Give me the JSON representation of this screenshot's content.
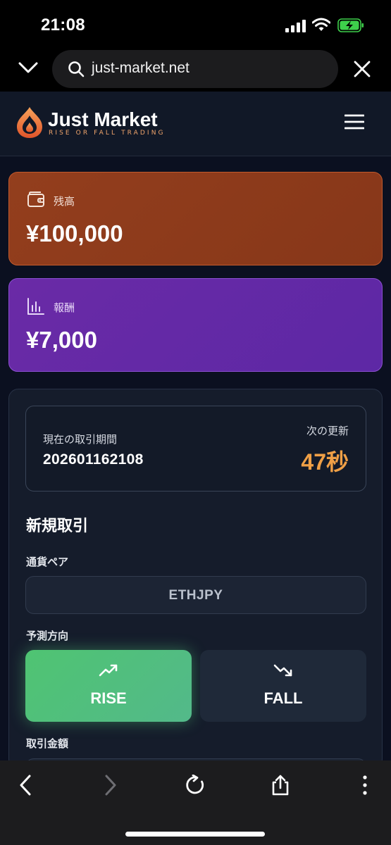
{
  "status_bar": {
    "time": "21:08"
  },
  "browser": {
    "url": "just-market.net"
  },
  "brand": {
    "name": "Just Market",
    "tagline": "RISE OR FALL TRADING",
    "accent": "#f0a46b"
  },
  "balance": {
    "label": "残高",
    "value": "¥100,000",
    "color": "#933e1d"
  },
  "reward": {
    "label": "報酬",
    "value": "¥7,000",
    "color": "#6a2aa6"
  },
  "trade": {
    "period_label": "現在の取引期間",
    "period_value": "202601162108",
    "next_update_label": "次の更新",
    "next_update_value": "47秒",
    "countdown_color": "#f0a046",
    "section_title": "新規取引",
    "pair_label": "通貨ペア",
    "pair_value": "ETHJPY",
    "direction_label": "予測方向",
    "rise_label": "RISE",
    "fall_label": "FALL",
    "selected_direction": "RISE",
    "rise_color": "#4fc472",
    "amount_label": "取引金額"
  },
  "icons": {
    "status": [
      "signal-icon",
      "wifi-icon",
      "battery-charging-icon"
    ],
    "browser": [
      "chevron-down-icon",
      "search-icon",
      "close-icon"
    ],
    "toolbar": [
      "back-arrow-icon",
      "forward-arrow-icon",
      "reload-icon",
      "share-icon",
      "more-icon"
    ],
    "app": [
      "flame-logo-icon",
      "hamburger-menu-icon",
      "wallet-icon",
      "bar-chart-icon",
      "trend-up-icon",
      "trend-down-icon"
    ]
  }
}
